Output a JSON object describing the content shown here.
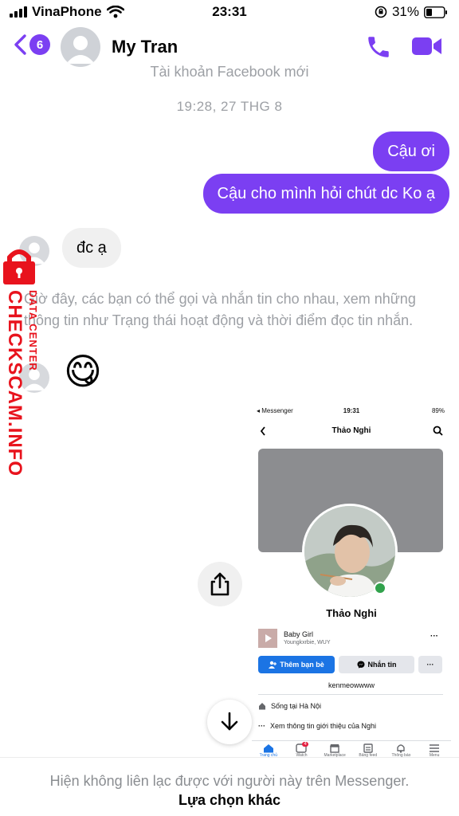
{
  "status_bar": {
    "carrier": "VinaPhone",
    "time": "23:31",
    "battery": "31%"
  },
  "header": {
    "unread_count": "6",
    "contact_name": "My Tran",
    "accent": "#7b3ff2"
  },
  "chat": {
    "partial_notice": "Tài khoản Facebook mới",
    "timestamp": "19:28, 27 THG 8",
    "out_messages": [
      "Cậu ơi",
      "Cậu cho mình hỏi chút dc Ko ạ"
    ],
    "in_message": "đc ạ",
    "system_info": "Giờ đây, các bạn có thể gọi và nhắn tin cho nhau, xem những thông tin như Trạng thái hoạt động và thời điểm đọc tin nhắn.",
    "emoji": "😋"
  },
  "watermark": {
    "site": "CHECKSCAM.INFO",
    "center": "DATA CENTER",
    "color": "#e8131d"
  },
  "shared_screenshot": {
    "status_app": "◂ Messenger",
    "status_time": "19:31",
    "status_battery": "89%",
    "title": "Thảo Nghi",
    "profile_name": "Thảo Nghi",
    "song_title": "Baby Girl",
    "song_artist": "Youngkxrbie, WUY",
    "add_friend_label": "Thêm bạn bè",
    "message_label": "Nhắn tin",
    "more_label": "···",
    "username": "kenmeowwww",
    "lives_in": "Sống tại Hà Nội",
    "see_intro": "Xem thông tin giới thiệu của Nghi",
    "tab_badge": "4",
    "tabs": [
      "Trang chủ",
      "Watch",
      "Marketplace",
      "Bảng feed",
      "Thông báo",
      "Menu"
    ]
  },
  "footer": {
    "note": "Hiện không liên lạc được với người này trên Messenger.",
    "action": "Lựa chọn khác"
  }
}
